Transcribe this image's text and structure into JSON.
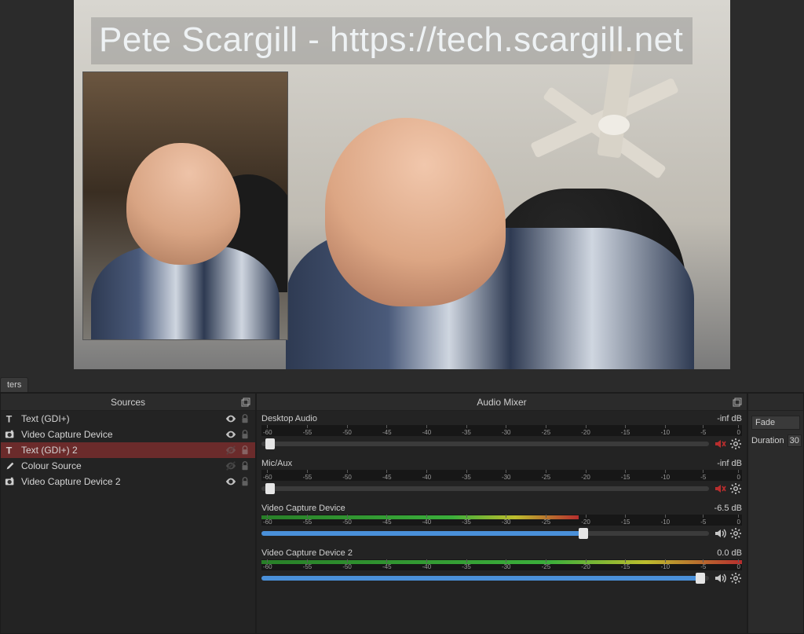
{
  "preview": {
    "overlay_text": "Pete Scargill - https://tech.scargill.net"
  },
  "tabs": {
    "filters": "ters"
  },
  "sources": {
    "title": "Sources",
    "items": [
      {
        "label": "Text (GDI+)",
        "icon": "text",
        "visible": true,
        "locked": false,
        "selected": false
      },
      {
        "label": "Video Capture Device",
        "icon": "camera",
        "visible": true,
        "locked": false,
        "selected": false
      },
      {
        "label": "Text (GDI+) 2",
        "icon": "text",
        "visible": false,
        "locked": false,
        "selected": true
      },
      {
        "label": "Colour Source",
        "icon": "brush",
        "visible": false,
        "locked": false,
        "selected": false
      },
      {
        "label": "Video Capture Device 2",
        "icon": "camera",
        "visible": true,
        "locked": false,
        "selected": false
      }
    ]
  },
  "mixer": {
    "title": "Audio Mixer",
    "scale_labels": [
      "-60",
      "-55",
      "-50",
      "-45",
      "-40",
      "-35",
      "-30",
      "-25",
      "-20",
      "-15",
      "-10",
      "-5",
      "0"
    ],
    "channels": [
      {
        "name": "Desktop Audio",
        "db": "-inf dB",
        "muted": true,
        "level_pct": 0,
        "slider_pct": 2
      },
      {
        "name": "Mic/Aux",
        "db": "-inf dB",
        "muted": true,
        "level_pct": 0,
        "slider_pct": 2
      },
      {
        "name": "Video Capture Device",
        "db": "-6.5 dB",
        "muted": false,
        "level_pct": 66,
        "slider_pct": 72
      },
      {
        "name": "Video Capture Device 2",
        "db": "0.0 dB",
        "muted": false,
        "level_pct": 100,
        "slider_pct": 98
      }
    ]
  },
  "transitions": {
    "fade_label": "Fade",
    "duration_label": "Duration",
    "duration_value": "30"
  }
}
